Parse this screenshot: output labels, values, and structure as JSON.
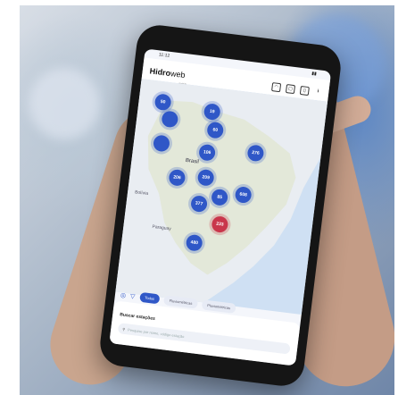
{
  "status": {
    "time": "11:12",
    "battery": "▮▮"
  },
  "app": {
    "brand_bold": "Hidro",
    "brand_light": "web",
    "brand_sub": "mobile"
  },
  "map": {
    "country_label": "Brasil",
    "bolivia": "Bolívia",
    "paraguay": "Paraguay",
    "clusters": [
      {
        "label": "50",
        "color": "blue"
      },
      {
        "label": "19",
        "color": "blue"
      },
      {
        "label": "60",
        "color": "blue"
      },
      {
        "label": "276",
        "color": "blue"
      },
      {
        "label": "106",
        "color": "blue"
      },
      {
        "label": "206",
        "color": "blue"
      },
      {
        "label": "209",
        "color": "blue"
      },
      {
        "label": "85",
        "color": "blue"
      },
      {
        "label": "608",
        "color": "blue"
      },
      {
        "label": "377",
        "color": "blue"
      },
      {
        "label": "233",
        "color": "blue"
      },
      {
        "label": "480",
        "color": "blue"
      }
    ]
  },
  "filters": {
    "chip_1": "Todas",
    "chip_2": "Fluviométricas",
    "chip_3": "Pluviométricas"
  },
  "sheet": {
    "title": "Buscar estações",
    "search_placeholder": "Pesquise por nome, código estação"
  }
}
